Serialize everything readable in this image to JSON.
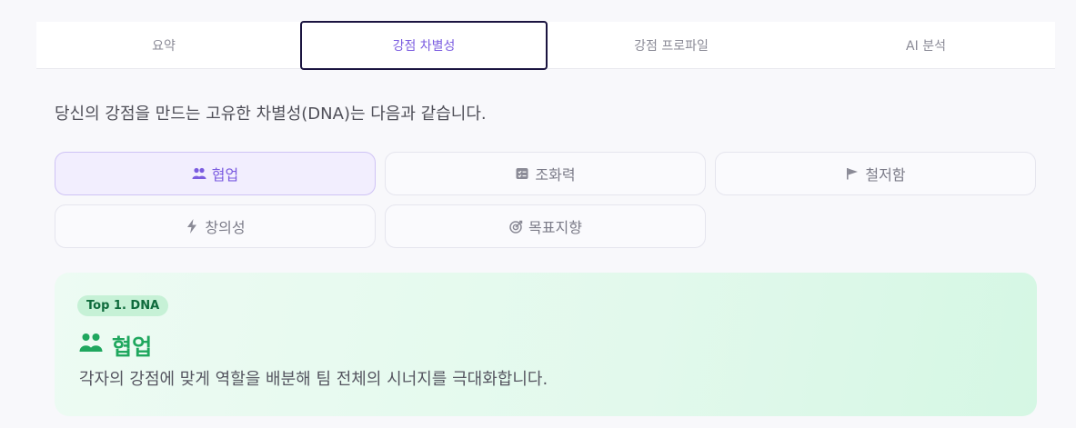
{
  "tabs": [
    {
      "label": "요약",
      "active": false
    },
    {
      "label": "강점 차별성",
      "active": true
    },
    {
      "label": "강점 프로파일",
      "active": false
    },
    {
      "label": "AI 분석",
      "active": false
    }
  ],
  "intro": "당신의 강점을 만드는 고유한 차별성(DNA)는 다음과 같습니다.",
  "chips": [
    {
      "label": "협업",
      "icon": "people-icon",
      "active": true
    },
    {
      "label": "조화력",
      "icon": "checklist-icon",
      "active": false
    },
    {
      "label": "철저함",
      "icon": "flag-icon",
      "active": false
    },
    {
      "label": "창의성",
      "icon": "lightning-icon",
      "active": false
    },
    {
      "label": "목표지향",
      "icon": "target-icon",
      "active": false
    }
  ],
  "card": {
    "badge": "Top 1. DNA",
    "title": "협업",
    "icon": "people-icon",
    "description": "각자의 강점에 맞게 역할을 배분해 팀 전체의 시너지를 극대화합니다."
  },
  "colors": {
    "accent": "#7b5ce0",
    "green": "#1fa75e",
    "card_bg": "#e2f9ec"
  }
}
